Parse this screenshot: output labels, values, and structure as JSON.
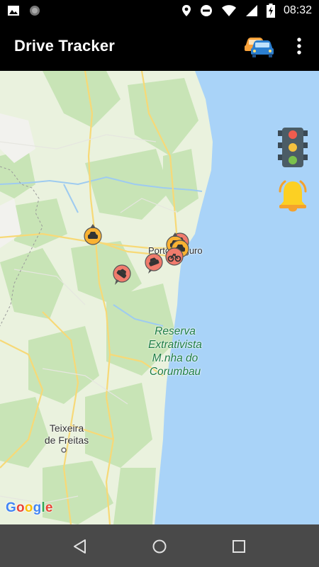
{
  "status_bar": {
    "time": "08:32",
    "icons": [
      "image-icon",
      "sync-icon",
      "location-icon",
      "do-not-disturb-icon",
      "wifi-icon",
      "signal-icon",
      "battery-charging-icon"
    ]
  },
  "app_bar": {
    "title": "Drive Tracker",
    "actions": [
      "cars-icon",
      "overflow-menu-icon"
    ]
  },
  "map": {
    "labels": {
      "porto_seguro": "Porto Seguro",
      "reserve_line1": "Reserva",
      "reserve_line2": "Extrativista",
      "reserve_line3": "M.nha do",
      "reserve_line4": "Corumbau",
      "teixeira_line1": "Teixeira",
      "teixeira_line2": "de Freitas"
    },
    "attribution": {
      "letters": [
        "G",
        "o",
        "o",
        "g",
        "l",
        "e"
      ]
    },
    "overlay_buttons": [
      "traffic-light-icon",
      "alarm-bell-icon"
    ],
    "markers": [
      {
        "kind": "car",
        "color": "#f9b233"
      },
      {
        "kind": "car",
        "color": "#f9b233"
      },
      {
        "kind": "car",
        "color": "#f9b233"
      },
      {
        "kind": "bike",
        "color": "#f07b6c"
      },
      {
        "kind": "car",
        "color": "#f07b6c"
      },
      {
        "kind": "crash",
        "color": "#f07b6c"
      }
    ]
  },
  "nav_bar": {
    "buttons": [
      "back-icon",
      "home-icon",
      "recents-icon"
    ]
  },
  "colors": {
    "sea": "#a9d3f8",
    "land": "#e9f1dd",
    "forest": "#c6e3b5",
    "road": "#fbe39a",
    "marker_yellow": "#f9b233",
    "marker_red": "#f07b6c",
    "reserve_text": "#1e7d44"
  }
}
